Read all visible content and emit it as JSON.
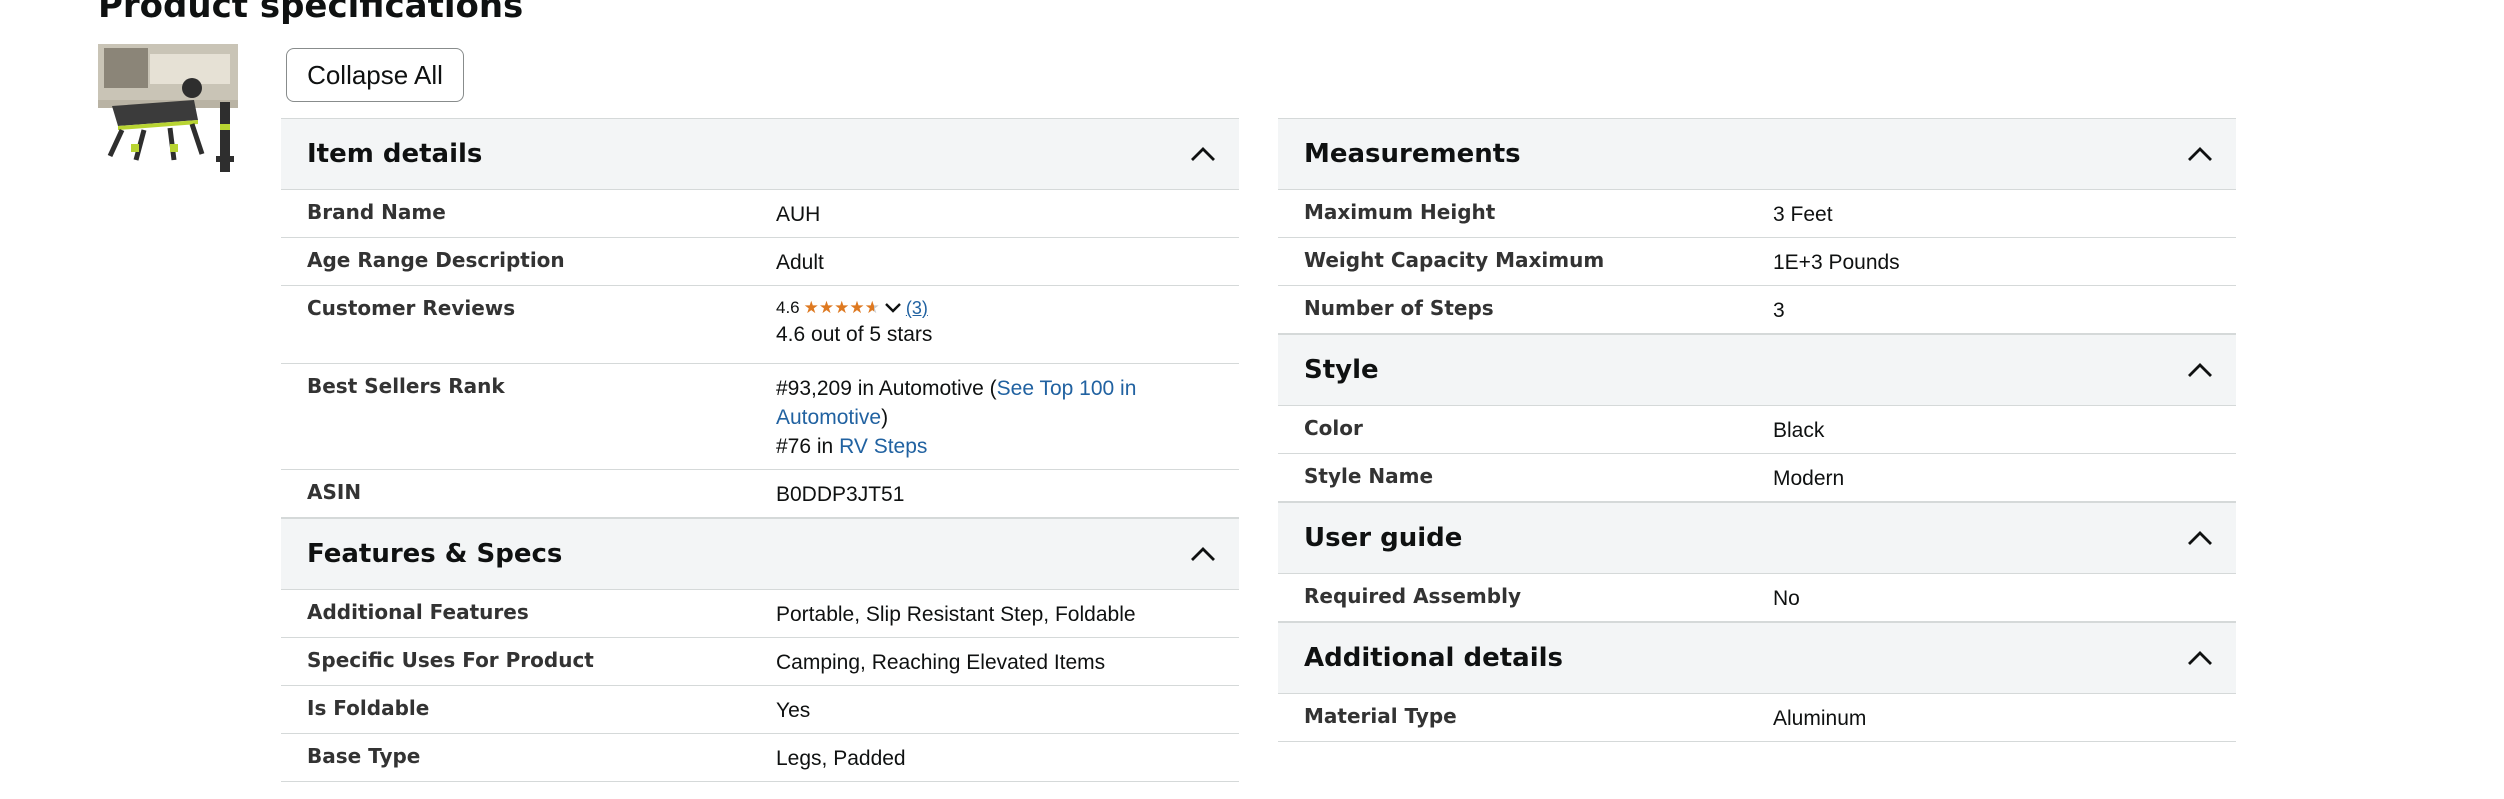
{
  "page": {
    "title": "Product specifications"
  },
  "toolbar": {
    "collapse_all_label": "Collapse All"
  },
  "left_column": [
    {
      "title": "Item details",
      "rows": [
        {
          "label": "Brand Name",
          "value": "AUH"
        },
        {
          "label": "Age Range Description",
          "value": "Adult"
        },
        {
          "label": "Customer Reviews",
          "value": ""
        },
        {
          "label": "Best Sellers Rank",
          "value": ""
        },
        {
          "label": "ASIN",
          "value": "B0DDP3JT51"
        }
      ]
    },
    {
      "title": "Features & Specs",
      "rows": [
        {
          "label": "Additional Features",
          "value": "Portable, Slip Resistant Step, Foldable"
        },
        {
          "label": "Specific Uses For Product",
          "value": "Camping, Reaching Elevated Items"
        },
        {
          "label": "Is Foldable",
          "value": "Yes"
        },
        {
          "label": "Base Type",
          "value": "Legs, Padded"
        }
      ]
    }
  ],
  "right_column": [
    {
      "title": "Measurements",
      "rows": [
        {
          "label": "Maximum Height",
          "value": "3 Feet"
        },
        {
          "label": "Weight Capacity Maximum",
          "value": "1E+3 Pounds"
        },
        {
          "label": "Number of Steps",
          "value": "3"
        }
      ]
    },
    {
      "title": "Style",
      "rows": [
        {
          "label": "Color",
          "value": "Black"
        },
        {
          "label": "Style Name",
          "value": "Modern"
        }
      ]
    },
    {
      "title": "User guide",
      "rows": [
        {
          "label": "Required Assembly",
          "value": "No"
        }
      ]
    },
    {
      "title": "Additional details",
      "rows": [
        {
          "label": "Material Type",
          "value": "Aluminum"
        }
      ]
    }
  ],
  "reviews": {
    "rating": "4.6",
    "rating_value": 4.6,
    "rating_max": 5,
    "count_text": "(3)",
    "summary": "4.6 out of 5 stars"
  },
  "bestsellers": {
    "rank1": "#93,209 in Automotive (",
    "link1": "See Top 100 in Automotive",
    "rank1_close": ")",
    "rank2": "#76 in ",
    "link2": "RV Steps"
  },
  "colors": {
    "header_bg": "#f3f5f6",
    "divider": "#d5d9d9",
    "link": "#2162a1",
    "star": "#de7921"
  },
  "icons": {
    "section_toggle": "chevron-up-icon",
    "rating_dropdown": "chevron-down-icon",
    "star": "star-icon"
  }
}
